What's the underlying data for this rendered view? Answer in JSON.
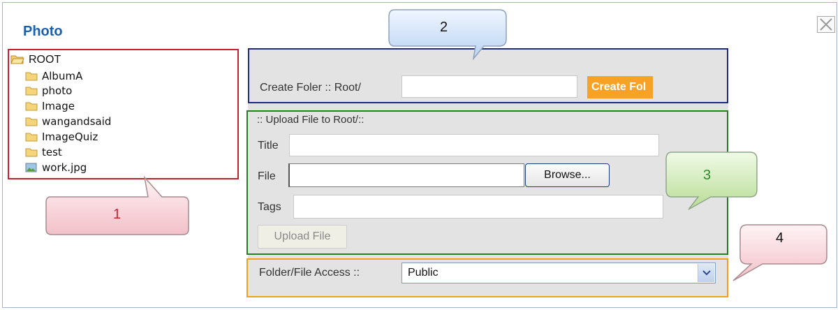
{
  "window": {
    "title": "Photo"
  },
  "tree": {
    "root": "ROOT",
    "items": [
      {
        "label": "AlbumA",
        "icon": "folder-icon"
      },
      {
        "label": "photo",
        "icon": "folder-icon"
      },
      {
        "label": "Image",
        "icon": "folder-icon"
      },
      {
        "label": "wangandsaid",
        "icon": "folder-icon"
      },
      {
        "label": "ImageQuiz",
        "icon": "folder-icon"
      },
      {
        "label": "test",
        "icon": "folder-icon"
      },
      {
        "label": "work.jpg",
        "icon": "image-file-icon"
      }
    ]
  },
  "create_folder": {
    "label": "Create Foler :: Root/",
    "value": "",
    "button": "Create Fol"
  },
  "upload": {
    "heading": ":: Upload File to Root/::",
    "title_label": "Title",
    "title_value": "",
    "file_label": "File",
    "file_value": "",
    "browse": "Browse...",
    "tags_label": "Tags",
    "tags_value": "",
    "button": "Upload File"
  },
  "access": {
    "label": "Folder/File Access ::",
    "selected": "Public"
  },
  "callouts": [
    "1",
    "2",
    "3",
    "4"
  ],
  "colors": {
    "title": "#1d5fa8",
    "box_tree": "#c2222b",
    "box_create": "#1e2a7a",
    "box_upload": "#238020",
    "box_access": "#f0a21b",
    "create_button": "#f7a125"
  }
}
